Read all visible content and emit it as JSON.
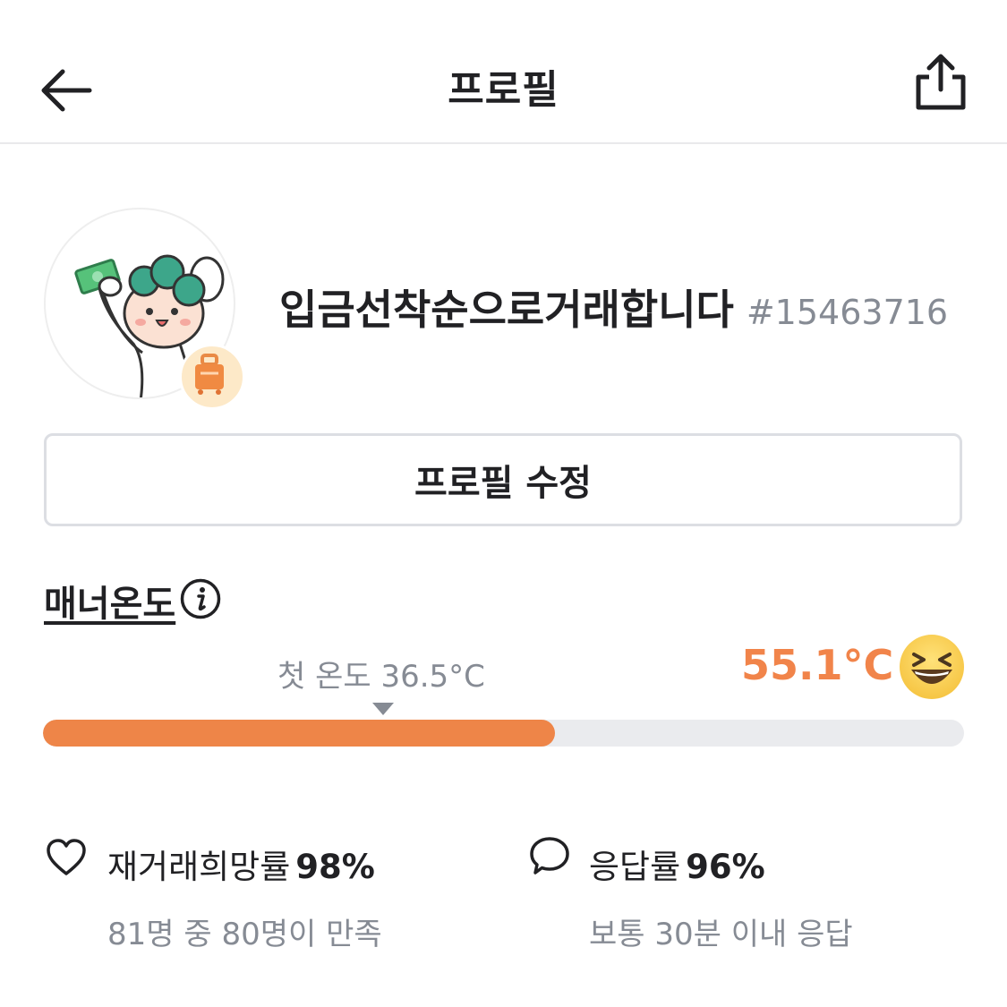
{
  "header": {
    "title": "프로필"
  },
  "profile": {
    "nickname": "입금선착순으로거래합니다",
    "user_id": "#15463716",
    "edit_label": "프로필 수정"
  },
  "manner": {
    "title": "매너온도",
    "first_temp_label": "첫 온도 36.5°C",
    "temperature": "55.1°C",
    "progress_fraction": 0.551,
    "first_temp_fraction": 0.365
  },
  "stats": {
    "rebuy": {
      "label": "재거래희망률",
      "value": "98%",
      "sub": "81명 중 80명이 만족"
    },
    "response": {
      "label": "응답률",
      "value": "96%",
      "sub": "보통 30분 이내 응답"
    }
  },
  "colors": {
    "accent": "#ee8548",
    "temp_text": "#f1844a",
    "muted": "#868b94",
    "track": "#eaebee"
  },
  "icons": [
    "back-arrow-icon",
    "share-icon",
    "info-icon",
    "smile-emoji-icon",
    "heart-icon",
    "speech-bubble-icon",
    "suitcase-badge-icon"
  ]
}
